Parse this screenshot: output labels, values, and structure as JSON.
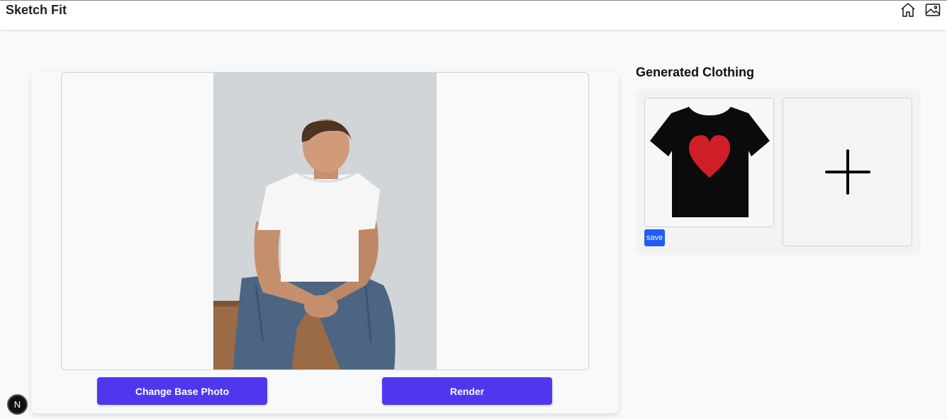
{
  "app": {
    "title": "Sketch Fit"
  },
  "nav": {
    "home_icon": "home-icon",
    "gallery_icon": "image-gallery-icon"
  },
  "editor": {
    "change_photo_label": "Change Base Photo",
    "render_label": "Render"
  },
  "sidebar": {
    "title": "Generated Clothing",
    "items": [
      {
        "type": "black t-shirt with red heart",
        "save_label": "save"
      }
    ],
    "add_icon": "plus-icon"
  },
  "dev_badge": {
    "label": "N"
  },
  "colors": {
    "accent": "#5037ef",
    "save": "#1f5cf5",
    "background": "#f8f9fb",
    "shirt": "#0b0b0b",
    "heart": "#d01f26"
  }
}
